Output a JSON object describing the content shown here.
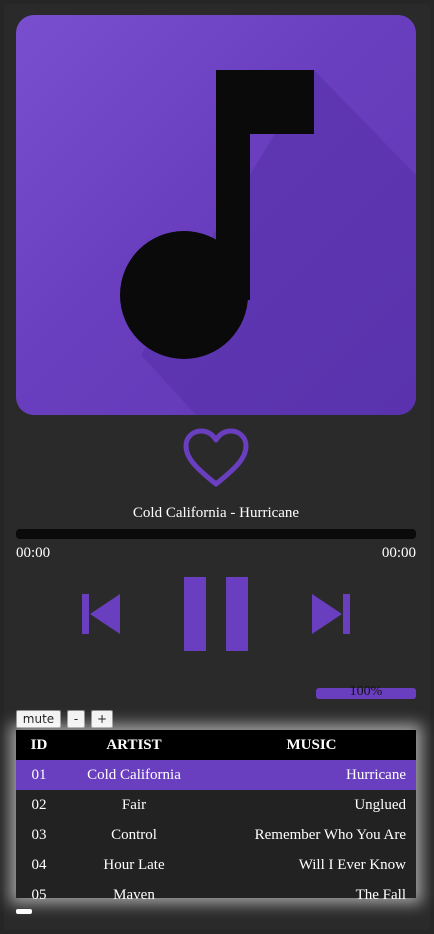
{
  "player": {
    "now_playing": "Cold California - Hurricane",
    "time_current": "00:00",
    "time_total": "00:00",
    "progress": 0,
    "volume_label": "100%",
    "volume": 1.0
  },
  "controls": {
    "mute_label": "mute",
    "minus_label": "-",
    "plus_label": "+"
  },
  "colors": {
    "accent": "#6a3fbf",
    "background": "#262626",
    "header": "#000000"
  },
  "icons": {
    "cover": "music-note-icon",
    "favorite": "heart-outline-icon",
    "previous": "skip-previous-icon",
    "pause": "pause-icon",
    "next": "skip-next-icon"
  },
  "playlist": {
    "headers": {
      "id": "ID",
      "artist": "ARTIST",
      "music": "MUSIC"
    },
    "rows": [
      {
        "id": "01",
        "artist": "Cold California",
        "music": "Hurricane",
        "active": true
      },
      {
        "id": "02",
        "artist": "Fair",
        "music": "Unglued",
        "active": false
      },
      {
        "id": "03",
        "artist": "Control",
        "music": "Remember Who You Are",
        "active": false
      },
      {
        "id": "04",
        "artist": "Hour Late",
        "music": "Will I Ever Know",
        "active": false
      },
      {
        "id": "05",
        "artist": "Maven",
        "music": "The Fall",
        "active": false
      }
    ]
  }
}
